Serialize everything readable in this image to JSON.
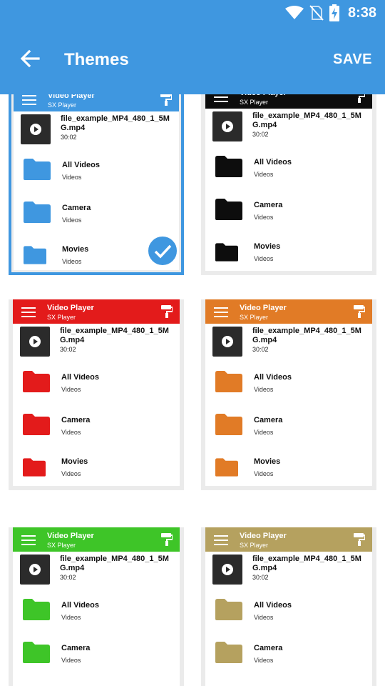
{
  "status": {
    "time": "8:38"
  },
  "appbar": {
    "title": "Themes",
    "save_label": "SAVE"
  },
  "preview": {
    "title": "Video Player",
    "subtitle": "SX Player",
    "file_name": "file_example_MP4_480_1_5MG.mp4",
    "file_duration": "30:02",
    "folders": [
      {
        "label": "All Videos",
        "sub": "Videos"
      },
      {
        "label": "Camera",
        "sub": "Videos"
      },
      {
        "label": "Movies",
        "sub": "Videos"
      }
    ]
  },
  "themes": [
    {
      "name": "blue",
      "color": "#3f97e0",
      "selected": true
    },
    {
      "name": "black",
      "color": "#0d0d0d",
      "selected": false
    },
    {
      "name": "red",
      "color": "#e31b1b",
      "selected": false
    },
    {
      "name": "orange",
      "color": "#e17b26",
      "selected": false
    },
    {
      "name": "green",
      "color": "#3ec528",
      "selected": false
    },
    {
      "name": "khaki",
      "color": "#b5a15f",
      "selected": false
    }
  ],
  "colors": {
    "primary": "#3f97e0"
  }
}
